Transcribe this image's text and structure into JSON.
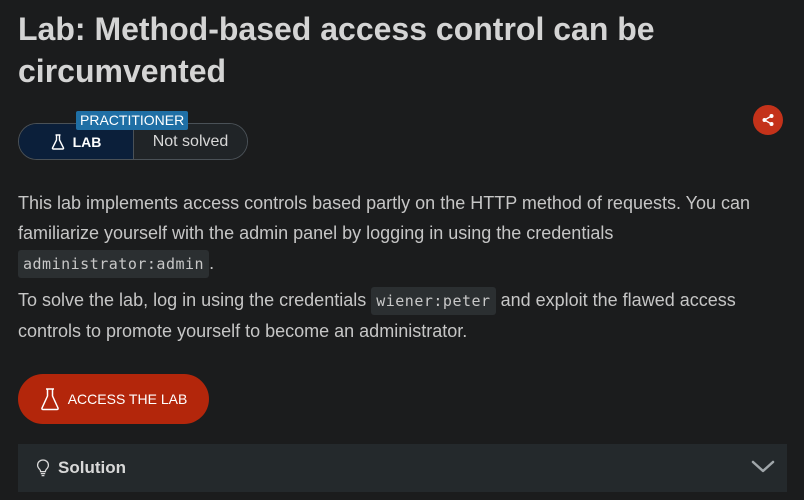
{
  "page": {
    "title": "Lab: Method-based access control can be circumvented"
  },
  "level": {
    "badge": "PRACTITIONER",
    "lab_label": "LAB",
    "status": "Not solved"
  },
  "description": {
    "p1_before": "This lab implements access controls based partly on the HTTP method of requests. You can familiarize yourself with the admin panel by logging in using the credentials ",
    "p1_code": "administrator:admin",
    "p1_after": ".",
    "p2_before": "To solve the lab, log in using the credentials ",
    "p2_code": "wiener:peter",
    "p2_after": " and exploit the flawed access controls to promote yourself to become an administrator."
  },
  "actions": {
    "access_lab": "ACCESS THE LAB"
  },
  "solution": {
    "label": "Solution"
  },
  "icons": {
    "share": "share-icon",
    "flask": "flask-icon",
    "lightbulb": "lightbulb-icon",
    "chevron": "chevron-down-icon"
  },
  "colors": {
    "background": "#1b1c1d",
    "accent": "#b3260b",
    "share": "#c4321a",
    "badge": "#1f6fa5",
    "lab_pill": "#0b1f3a",
    "solution_bar": "#24292c"
  }
}
